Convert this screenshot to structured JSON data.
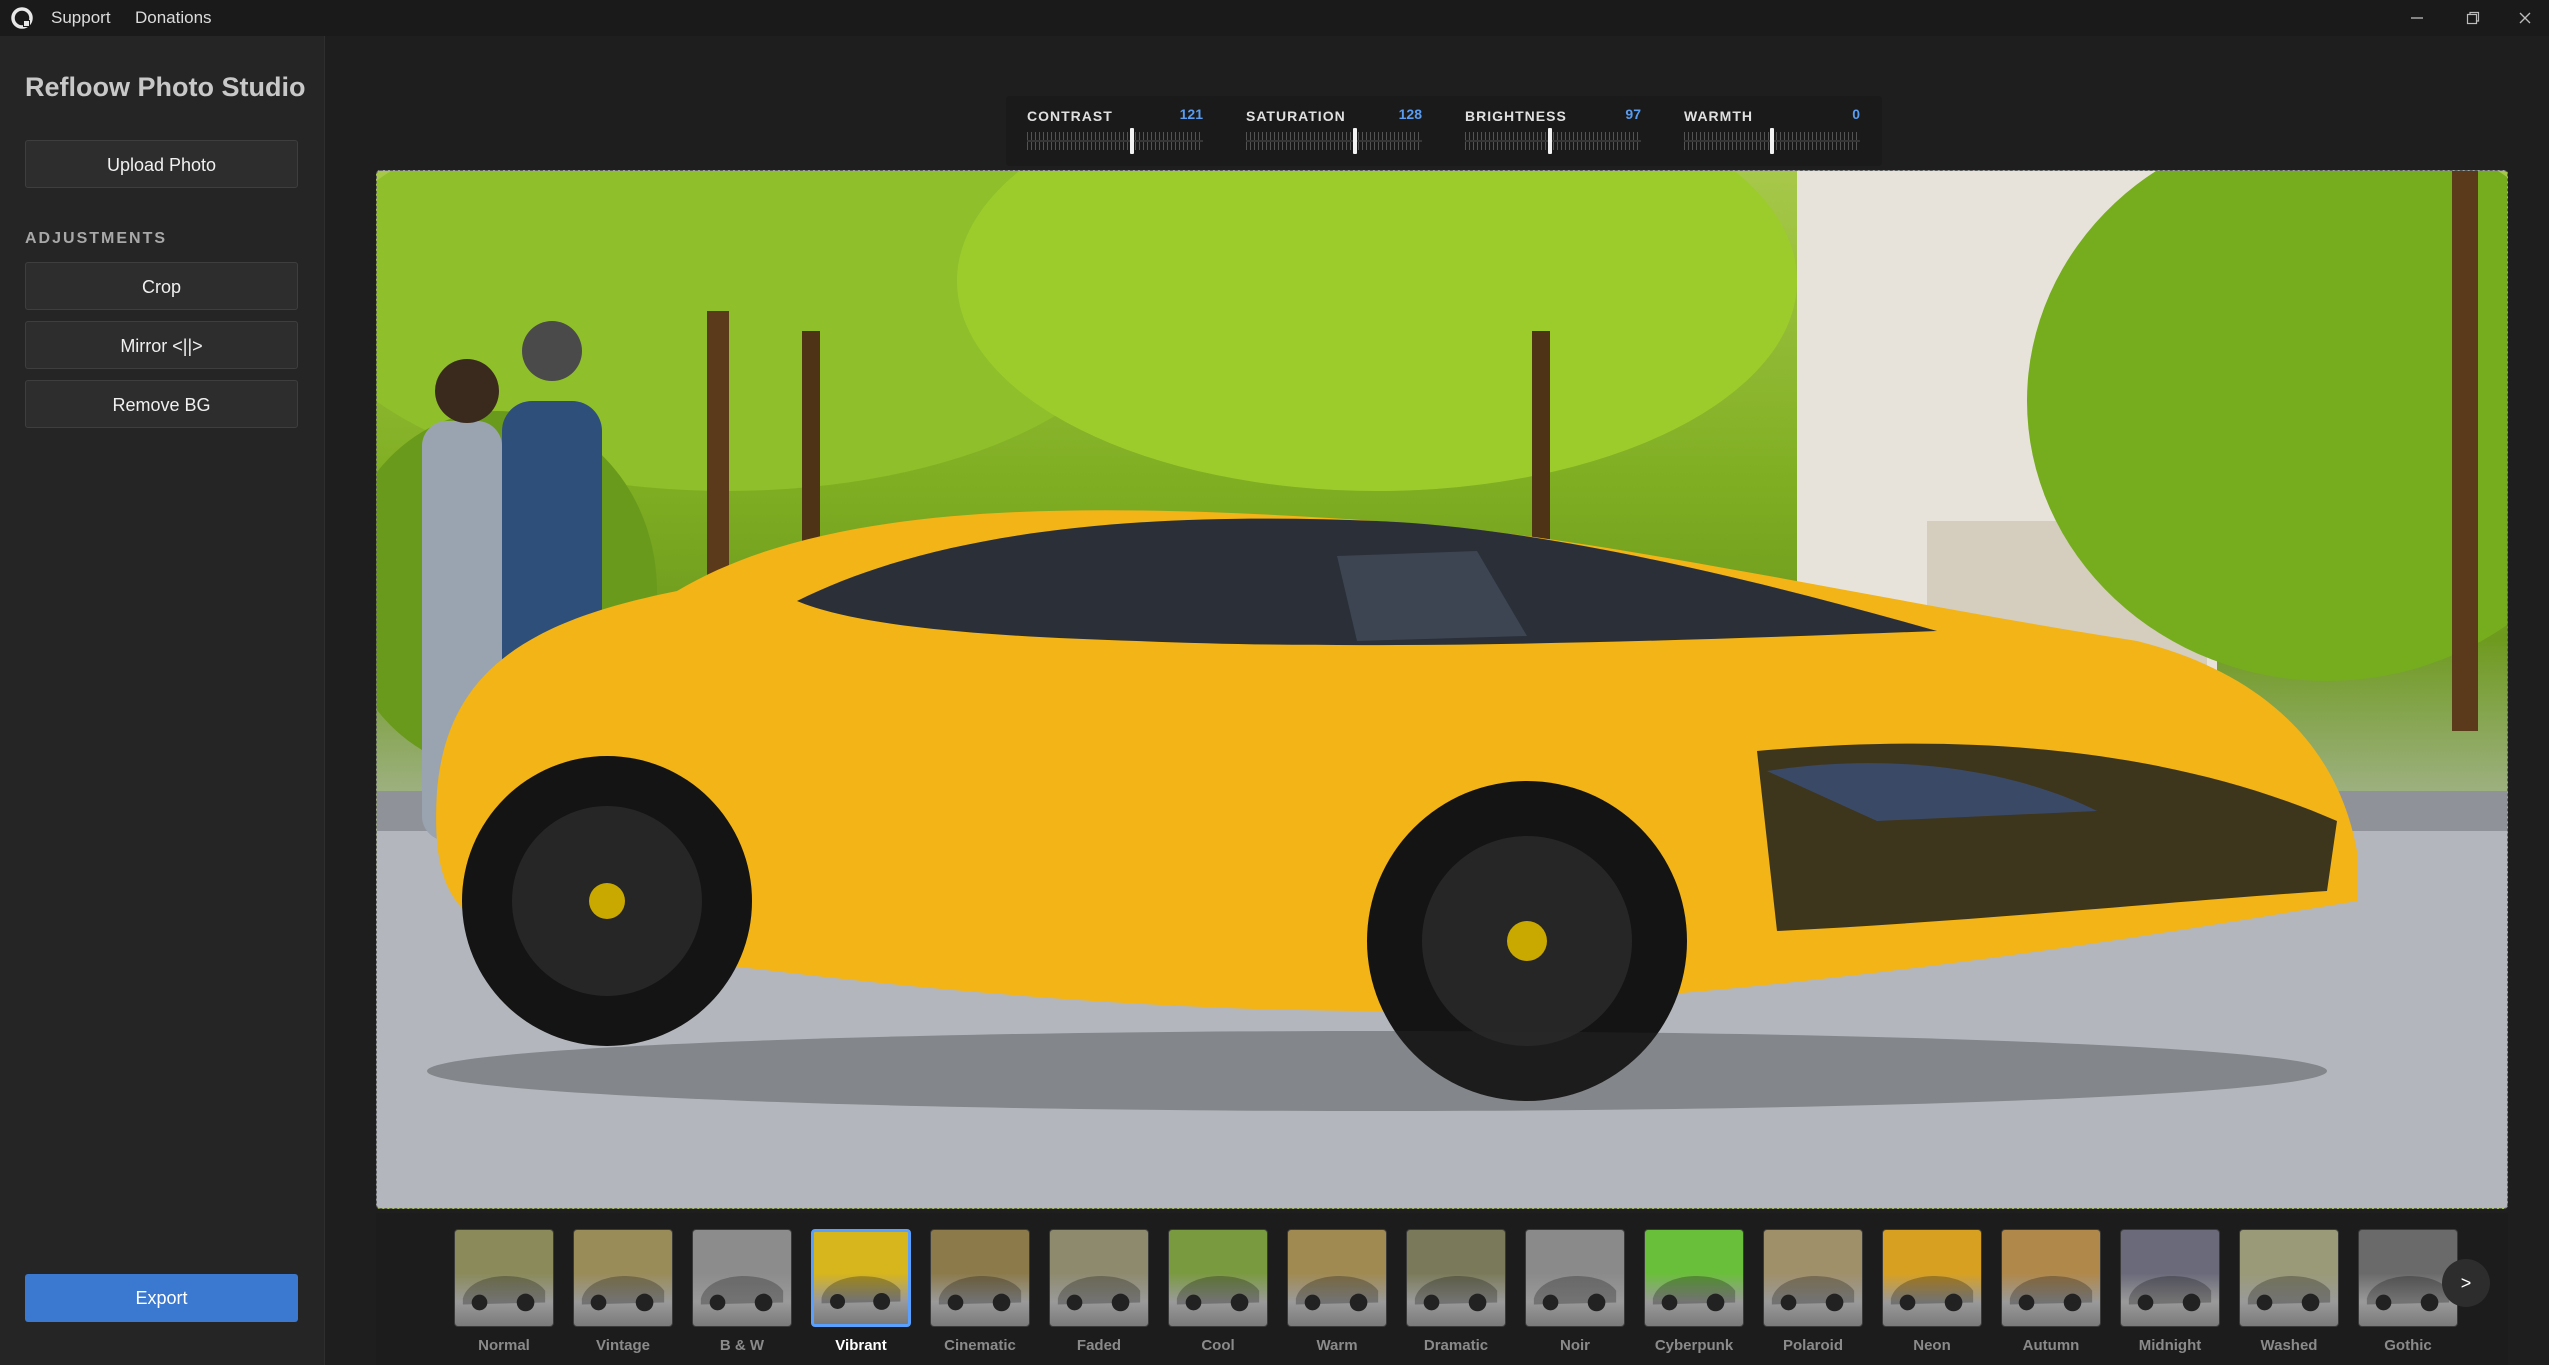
{
  "titlebar": {
    "menu": [
      "Support",
      "Donations"
    ],
    "window_controls": [
      "minimize-icon",
      "restore-icon",
      "close-icon"
    ]
  },
  "sidebar": {
    "app_title": "Refloow Photo Studio",
    "upload_label": "Upload Photo",
    "section_label": "ADJUSTMENTS",
    "crop_label": "Crop",
    "mirror_label": "Mirror <||>",
    "remove_bg_label": "Remove BG",
    "export_label": "Export",
    "accent_color": "#3b78d0"
  },
  "sliders": [
    {
      "label": "CONTRAST",
      "value": "121",
      "level": 0.6
    },
    {
      "label": "SATURATION",
      "value": "128",
      "level": 0.62
    },
    {
      "label": "BRIGHTNESS",
      "value": "97",
      "level": 0.48
    },
    {
      "label": "WARMTH",
      "value": "0",
      "level": 0.5
    }
  ],
  "filters": [
    {
      "label": "Normal",
      "active": false
    },
    {
      "label": "Vintage",
      "active": false
    },
    {
      "label": "B & W",
      "active": false
    },
    {
      "label": "Vibrant",
      "active": true
    },
    {
      "label": "Cinematic",
      "active": false
    },
    {
      "label": "Faded",
      "active": false
    },
    {
      "label": "Cool",
      "active": false
    },
    {
      "label": "Warm",
      "active": false
    },
    {
      "label": "Dramatic",
      "active": false
    },
    {
      "label": "Noir",
      "active": false
    },
    {
      "label": "Cyberpunk",
      "active": false
    },
    {
      "label": "Polaroid",
      "active": false
    },
    {
      "label": "Neon",
      "active": false
    },
    {
      "label": "Autumn",
      "active": false
    },
    {
      "label": "Midnight",
      "active": false
    },
    {
      "label": "Washed",
      "active": false
    },
    {
      "label": "Gothic",
      "active": false
    }
  ],
  "next_label": ">"
}
